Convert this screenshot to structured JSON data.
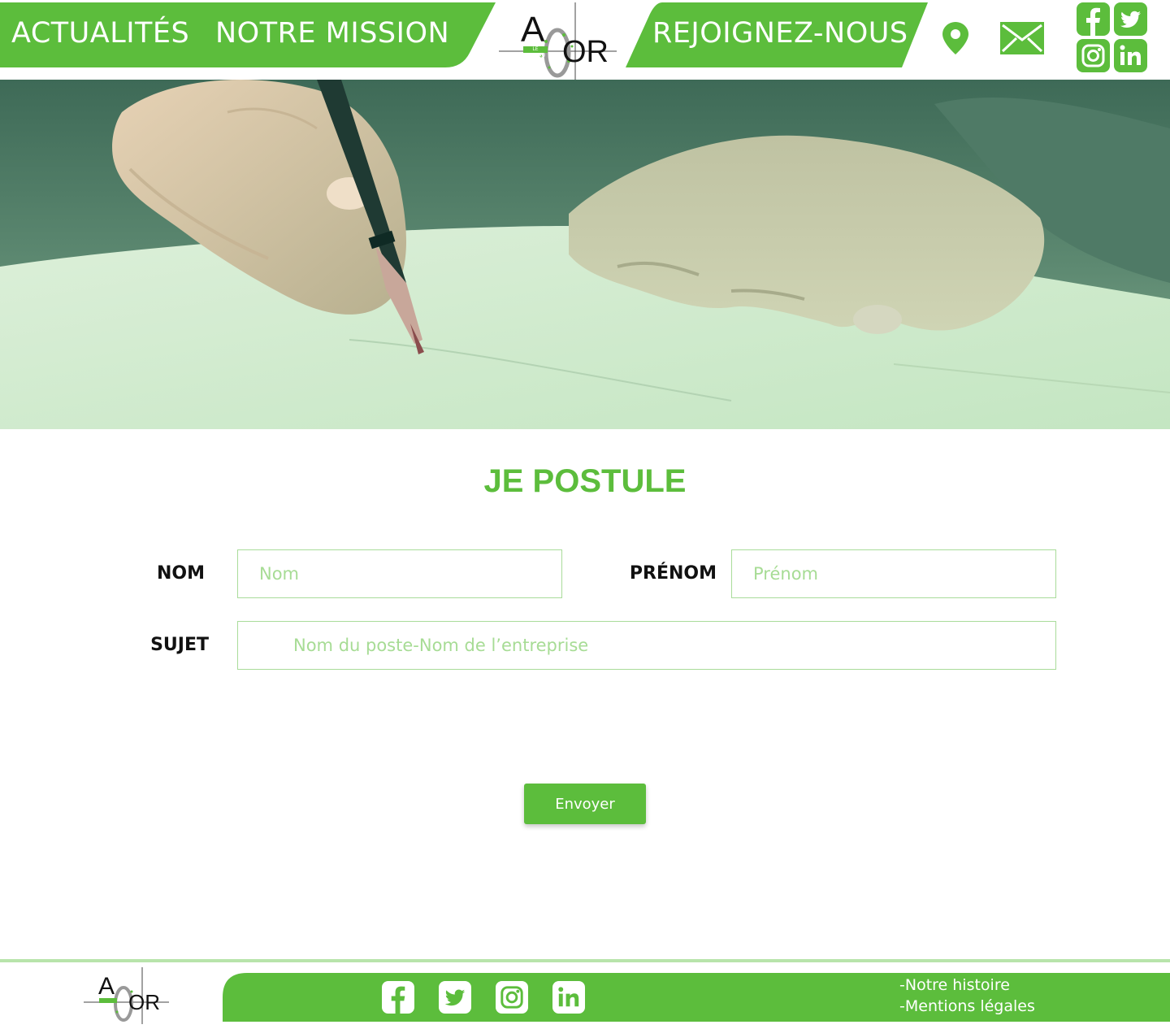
{
  "header": {
    "nav": {
      "actualites": "ACTUALITÉS",
      "mission": "NOTRE MISSION",
      "join": "REJOIGNEZ-NOUS"
    },
    "logo": {
      "main_a": "A",
      "main_or": "OR",
      "tag": "LE RESEAU"
    },
    "icons": [
      "location-icon",
      "mail-icon",
      "facebook-icon",
      "twitter-icon",
      "instagram-icon",
      "linkedin-icon"
    ]
  },
  "form": {
    "title": "JE POSTULE",
    "nom_label": "NOM",
    "nom_placeholder": "Nom",
    "prenom_label": "PRÉNOM",
    "prenom_placeholder": "Prénom",
    "sujet_label": "SUJET",
    "sujet_placeholder": "Nom du poste-Nom de l’entreprise",
    "submit_label": "Envoyer"
  },
  "footer": {
    "logo": {
      "main_a": "A",
      "main_or": "OR"
    },
    "icons": [
      "facebook-icon",
      "twitter-icon",
      "instagram-icon",
      "linkedin-icon"
    ],
    "links": [
      "-Notre histoire",
      "-Mentions légales"
    ]
  },
  "colors": {
    "brand_green": "#5cbd3c",
    "light_green_border": "#a9dc9a",
    "placeholder_green": "#a7dc95",
    "footer_line": "#b8e4ab"
  }
}
